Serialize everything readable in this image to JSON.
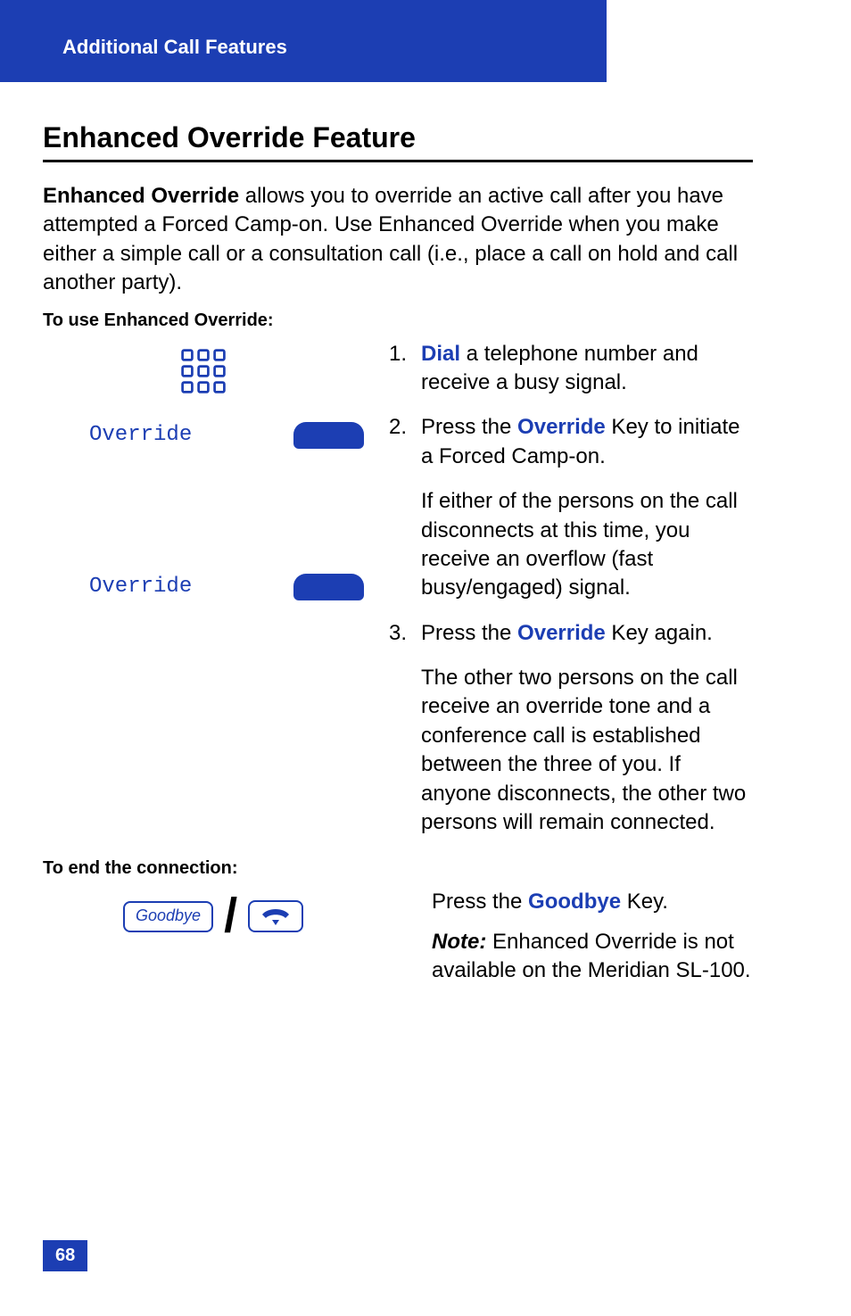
{
  "header": {
    "title": "Additional Call Features"
  },
  "section": {
    "heading": "Enhanced Override Feature",
    "intro_bold": "Enhanced Override",
    "intro_rest": " allows you to override an active call after you have attempted a Forced Camp-on. Use Enhanced Override when you make either a simple call or a consultation call (i.e., place a call on hold and call another party).",
    "use_heading": "To use Enhanced Override:",
    "end_heading": "To end the connection:"
  },
  "keys": {
    "override_label_1": "Override",
    "override_label_2": "Override",
    "goodbye_label": "Goodbye"
  },
  "steps": {
    "s1_num": "1.",
    "s1_action": "Dial",
    "s1_rest": " a telephone number and receive a busy signal.",
    "s2_num": "2.",
    "s2_pre": "Press the ",
    "s2_key": "Override",
    "s2_post": " Key to initiate a Forced Camp-on.",
    "s2_follow": "If either of the persons on the call disconnects at this time, you receive an overflow (fast busy/engaged) signal.",
    "s3_num": "3.",
    "s3_pre": "Press the ",
    "s3_key": "Override",
    "s3_post": " Key again.",
    "s3_follow": "The other two persons on the call receive an override tone and a conference call is established between the three of you. If anyone disconnects, the other two persons will remain connected."
  },
  "end": {
    "press_pre": "Press the ",
    "press_key": "Goodbye",
    "press_post": " Key.",
    "note_label": "Note:",
    "note_text": " Enhanced Override is not available on the Meridian SL-100."
  },
  "page_number": "68"
}
